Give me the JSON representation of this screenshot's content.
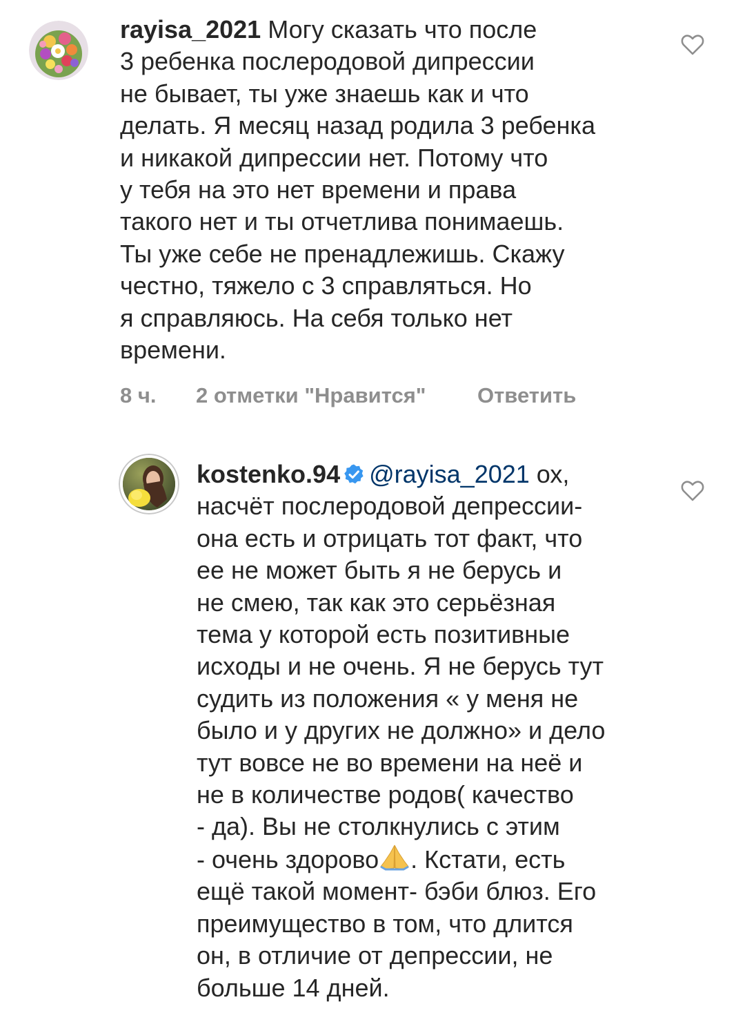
{
  "comments": [
    {
      "username": "rayisa_2021",
      "lines": [
        " Могу сказать что после",
        "3 ребенка послеродовой дипрессии",
        "не бывает, ты уже знаешь как и что",
        "делать. Я месяц назад родила 3 ребенка",
        "и никакой дипрессии нет. Потому что",
        "у тебя на это нет времени и права",
        "такого нет и ты отчетлива понимаешь.",
        "Ты уже себе не пренадлежишь. Скажу",
        "честно, тяжело с 3 справляться. Но",
        "я справляюсь. На себя только нет",
        "времени."
      ],
      "time": "8 ч.",
      "likes": "2 отметки \"Нравится\"",
      "reply_label": "Ответить",
      "avatar_icon": "flower-bouquet-avatar"
    },
    {
      "username": "kostenko.94",
      "verified": true,
      "mention": "@rayisa_2021",
      "first_line_rest": " ох,",
      "lines": [
        "насчёт послеродовой депрессии-",
        "она есть и отрицать тот факт, что",
        "ее не может быть я не берусь и",
        "не смею, так как это серьёзная",
        "тема  у которой есть позитивные",
        "исходы и не очень. Я не берусь тут",
        "судить из положения « у меня не",
        "было и у других не должно» и дело",
        "тут вовсе не во времени на неё и",
        "не в количестве родов( качество",
        "- да). Вы не столкнулись с этим",
        "- очень здорово",
        "ещё такой момент- бэби блюз. Его",
        "преимущество в том, что длится",
        "он, в отличие от депрессии, не",
        "больше 14 дней."
      ],
      "line_12_after_emoji": ". Кстати, есть",
      "emoji_icon": "folded-hands-emoji",
      "avatar_icon": "woman-portrait-avatar"
    }
  ],
  "colors": {
    "text": "#262626",
    "meta": "#8e8e8e",
    "mention": "#003569",
    "verified": "#3897f0",
    "avatar_ring": "#c8c8c8"
  }
}
